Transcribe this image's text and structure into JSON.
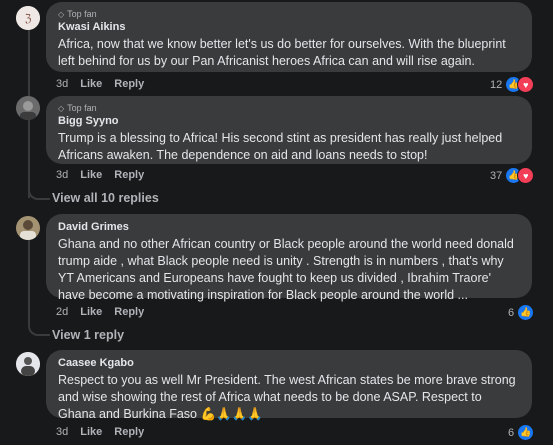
{
  "comments": [
    {
      "badge": "Top fan",
      "author": "Kwasi Aikins",
      "text": "Africa, now that we know better let's us do better for ourselves. With the blueprint left behind for us by our Pan Africanist heroes Africa can and will rise again.",
      "time": "3d",
      "like": "Like",
      "reply": "Reply",
      "count": "12"
    },
    {
      "badge": "Top fan",
      "author": "Bigg Syyno",
      "text": "Trump is a blessing to Africa! His second stint as president has really just helped Africans awaken. The dependence on aid and loans needs to stop!",
      "time": "3d",
      "like": "Like",
      "reply": "Reply",
      "count": "37"
    },
    {
      "author": "David Grimes",
      "text": "Ghana and no other African country or Black people around the world need donald trump aide , what Black people need is unity . Strength is in numbers , that's why YT Americans and Europeans have fought to keep us divided , Ibrahim Traore' have become a motivating inspiration for Black people around the world ...",
      "time": "2d",
      "like": "Like",
      "reply": "Reply",
      "count": "6"
    },
    {
      "author": "Caasee Kgabo",
      "text": "Respect to you as well Mr President. The west African states be more brave strong and wise showing the rest of Africa what needs to be done ASAP. Respect to Ghana and Burkina Faso 💪🙏🙏🙏",
      "time": "3d",
      "like": "Like",
      "reply": "Reply",
      "count": "6"
    }
  ],
  "view_all": "View all 10 replies",
  "view_one": "View 1 reply",
  "colors": {
    "bubble": "#3a3b3c",
    "background": "#18191a",
    "like": "#1877f2",
    "love": "#f33e58"
  },
  "icons": [
    "gem-icon",
    "like-reaction-icon",
    "love-reaction-icon",
    "avatar"
  ]
}
